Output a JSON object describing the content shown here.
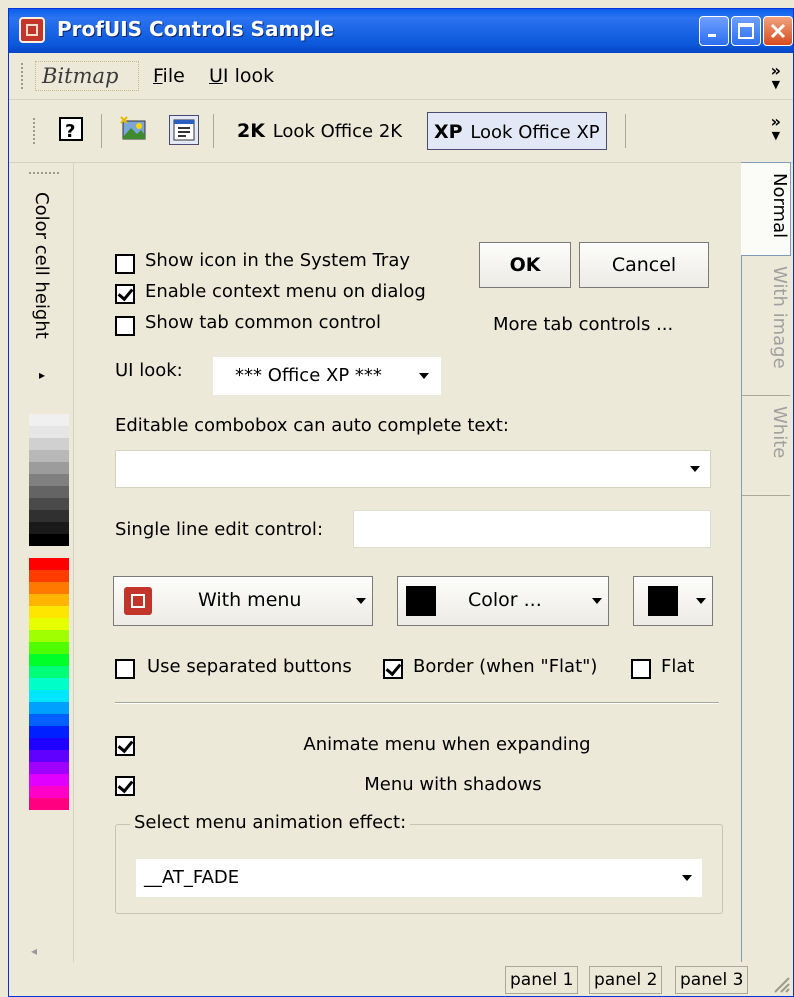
{
  "window": {
    "title": "ProfUIS Controls Sample"
  },
  "menubar": {
    "logo": "Bitmap",
    "file_first": "F",
    "file_rest": "ile",
    "uilook_first": "U",
    "uilook_rest": "I look",
    "overflow": "»"
  },
  "toolbar": {
    "look2k_badge": "2K",
    "look2k_label": "Look Office 2K",
    "lookxp_badge": "XP",
    "lookxp_label": "Look Office XP",
    "overflow": "»"
  },
  "left_panel": {
    "title": "Color cell height",
    "arrow": "▸",
    "colors": [
      "#f0f0f0",
      "#e6e6e6",
      "#d0d0d0",
      "#b8b8b8",
      "#9c9c9c",
      "#808080",
      "#646464",
      "#4a4a4a",
      "#303030",
      "#1a1a1a",
      "#000000",
      "#ece9d8",
      "#ff0000",
      "#ff3c00",
      "#ff7800",
      "#ffb400",
      "#ffe600",
      "#e6ff00",
      "#a0ff00",
      "#50ff00",
      "#00ff28",
      "#00ff78",
      "#00ffc8",
      "#00e6ff",
      "#00a0ff",
      "#0060ff",
      "#0020ff",
      "#2000ff",
      "#6000ff",
      "#a000ff",
      "#e000ff",
      "#ff00c8",
      "#ff0080"
    ]
  },
  "dialog": {
    "show_tray_label": "Show icon in the System Tray",
    "show_tray_checked": false,
    "context_menu_label": "Enable context menu on dialog",
    "context_menu_checked": true,
    "tab_control_label": "Show tab common control",
    "tab_control_checked": false,
    "ok_label": "OK",
    "cancel_label": "Cancel",
    "more_tabs_label": "More tab controls ...",
    "ui_look_label": "UI look:",
    "ui_look_value": "*** Office XP ***",
    "editable_combo_label": "Editable combobox can auto complete text:",
    "editable_combo_value": "",
    "single_edit_label": "Single line edit control:",
    "single_edit_value": "",
    "with_menu_label": "With menu",
    "color_label": "Color ...",
    "separated_label": "Use separated buttons",
    "separated_checked": false,
    "border_label": "Border (when \"Flat\")",
    "border_checked": true,
    "flat_label": "Flat",
    "flat_checked": false,
    "animate_label": "Animate menu when expanding",
    "animate_checked": true,
    "shadows_label": "Menu with shadows",
    "shadows_checked": true,
    "anim_group_title": "Select menu animation effect:",
    "anim_value": "__AT_FADE"
  },
  "right_tabs": {
    "normal": "Normal",
    "with_image": "With image",
    "white": "White"
  },
  "statusbar": {
    "panel1": "panel 1",
    "panel2": "panel 2",
    "panel3": "panel 3"
  }
}
